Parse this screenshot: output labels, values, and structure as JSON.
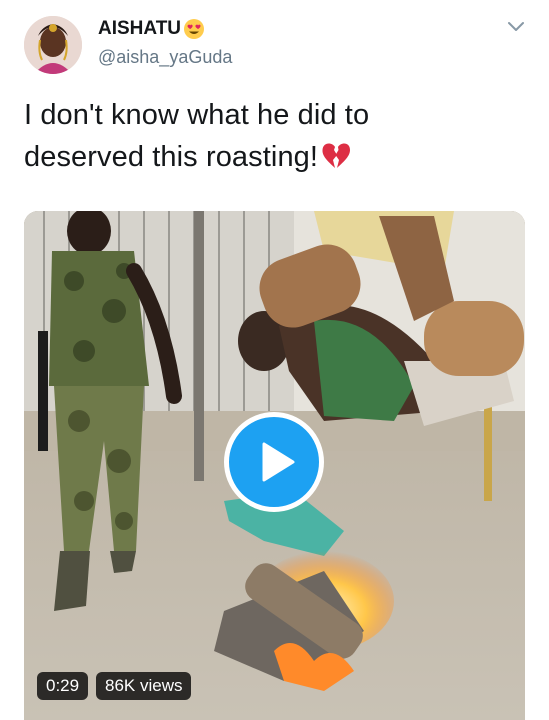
{
  "author": {
    "display_name": "AISHATU",
    "name_emoji": "heart-eyes-emoji",
    "handle": "@aisha_yaGuda",
    "avatar": "profile-avatar"
  },
  "tweet": {
    "line1": "I don't know what he did to",
    "line2": "deserved this roasting!",
    "line2_emoji": "broken-heart-emoji"
  },
  "media": {
    "type": "video",
    "duration": "0:29",
    "views": "86K views",
    "play_icon": "play-icon"
  },
  "colors": {
    "accent": "#1da1f2",
    "text": "#14171a",
    "secondary_text": "#657786",
    "broken_heart": "#dd2e44",
    "emoji_face": "#ffcc4d"
  },
  "icons": [
    "chevron-down-icon",
    "play-icon",
    "heart-eyes-emoji",
    "broken-heart-emoji"
  ]
}
